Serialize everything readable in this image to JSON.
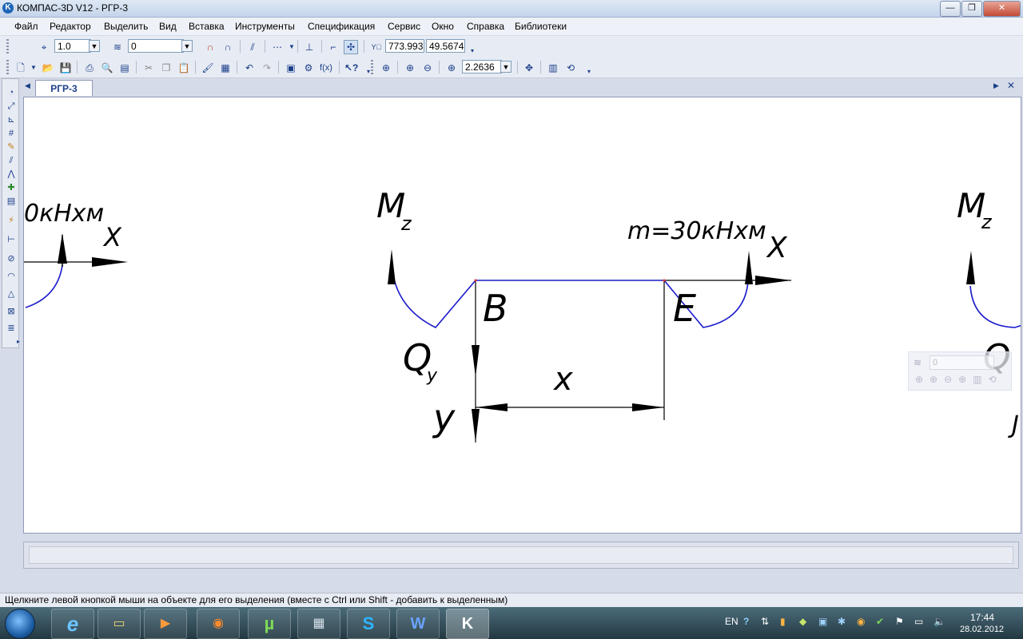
{
  "window": {
    "title": "КОМПАС-3D V12 - РГР-3",
    "app_icon": "kompas-logo-icon",
    "minimize_glyph": "—",
    "maximize_glyph": "❐",
    "close_glyph": "✕"
  },
  "menu": {
    "items": [
      "Файл",
      "Редактор",
      "Выделить",
      "Вид",
      "Вставка",
      "Инструменты",
      "Спецификация",
      "Сервис",
      "Окно",
      "Справка",
      "Библиотеки"
    ]
  },
  "toolbar1": {
    "step_value": "1.0",
    "layer_value": "0",
    "coord_x": "773.993",
    "coord_y": "49.5674",
    "icons": [
      "cursor-step-icon",
      "layer-icon",
      "magnet-icon",
      "snap-icon",
      "grid-icon",
      "axes-icon",
      "ortho-icon",
      "local-cs-icon"
    ]
  },
  "toolbar2": {
    "zoom_value": "2.2636",
    "icons": [
      "new-icon",
      "open-icon",
      "save-icon",
      "print-icon",
      "preview-icon",
      "print-setup-icon",
      "cut-icon",
      "copy-icon",
      "paste-icon",
      "format-painter-icon",
      "properties-icon",
      "undo-icon",
      "redo-icon",
      "manager-icon",
      "library-icon",
      "variables-icon",
      "help-pointer-icon",
      "zoom-window-icon",
      "zoom-in-icon",
      "zoom-out-icon",
      "zoom-scale-icon",
      "pan-icon",
      "refresh-icon",
      "redraw-icon"
    ]
  },
  "left_toolbar": {
    "icons": [
      "geometry-icon",
      "dimensions-icon",
      "designations-icon",
      "editing-icon",
      "parametrization-icon",
      "measure-icon",
      "select-icon",
      "associative-views-icon",
      "spec-icon",
      "reports-icon",
      "insert-icon",
      "graphics-icon",
      "arc-icon",
      "polygon-icon",
      "hatch-icon",
      "surface-icon",
      "fasteners-icon"
    ]
  },
  "tab": {
    "label": "РГР-3",
    "prev_glyph": "◀",
    "next_glyph": "▶",
    "close_glyph": "✕"
  },
  "drawing": {
    "left_moment_label": "0кНхм",
    "left_x_label": "X",
    "mz_main": "M",
    "mz_sub": "z",
    "point_b": "B",
    "point_e": "E",
    "m_label": "m=30кНхм",
    "x_axis_label": "X",
    "qy_main": "Q",
    "qy_sub": "y",
    "x_dim_label": "x",
    "y_axis_label": "y",
    "right_mz_main": "M",
    "right_mz_sub": "z",
    "right_q_main": "Q",
    "right_y_cut": "J",
    "line_color": "#1a1acc",
    "arrow_color": "#000000"
  },
  "ghost_panel": {
    "layer_value": "0"
  },
  "status": {
    "text": "Щелкните левой кнопкой мыши на объекте для его выделения (вместе с Ctrl или Shift - добавить к выделенным)"
  },
  "taskbar": {
    "start_icon": "windows-start-orb-icon",
    "apps": [
      {
        "name": "internet-explorer-icon",
        "glyph": "e"
      },
      {
        "name": "explorer-folder-icon",
        "glyph": "▭"
      },
      {
        "name": "media-player-icon",
        "glyph": "▶"
      },
      {
        "name": "firefox-icon",
        "glyph": "◉"
      },
      {
        "name": "utorrent-icon",
        "glyph": "µ"
      },
      {
        "name": "calculator-icon",
        "glyph": "▦"
      },
      {
        "name": "skype-icon",
        "glyph": "S"
      },
      {
        "name": "word-icon",
        "glyph": "W"
      },
      {
        "name": "kompas-icon",
        "glyph": "K"
      }
    ],
    "lang": "EN",
    "time": "17:44",
    "date": "28.02.2012"
  }
}
